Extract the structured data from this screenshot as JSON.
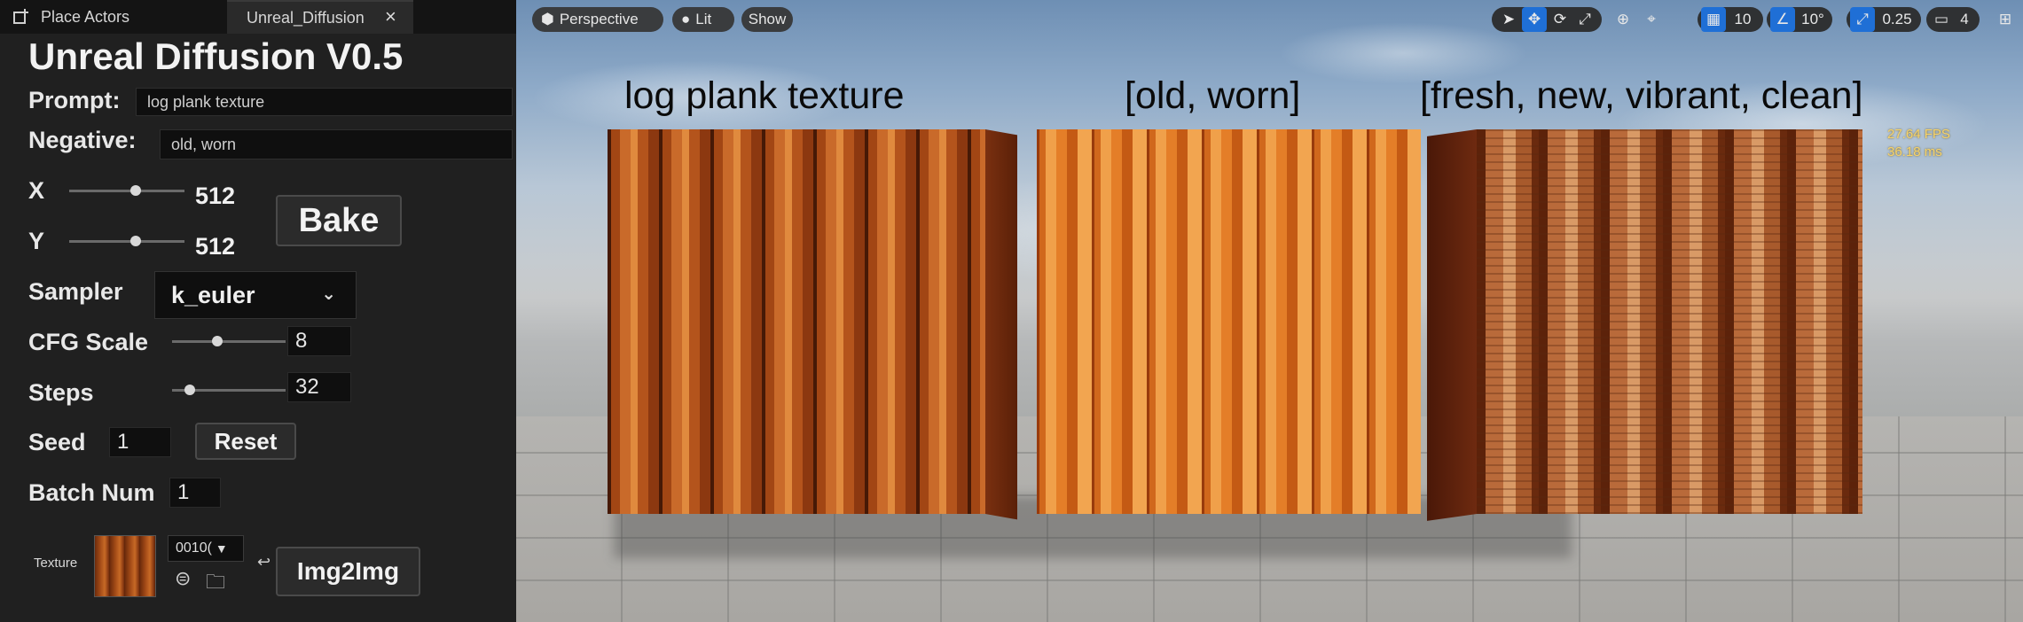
{
  "tabs": {
    "place_actors": "Place Actors",
    "unreal_diffusion": "Unreal_Diffusion"
  },
  "panel": {
    "title": "Unreal Diffusion V0.5",
    "prompt_label": "Prompt:",
    "prompt_value": "log plank texture",
    "negative_label": "Negative:",
    "negative_value": "old, worn",
    "x_label": "X",
    "x_value": "512",
    "x_slider_fraction": 0.58,
    "y_label": "Y",
    "y_value": "512",
    "y_slider_fraction": 0.58,
    "bake_label": "Bake",
    "sampler_label": "Sampler",
    "sampler_value": "k_euler",
    "cfg_label": "CFG Scale",
    "cfg_value": "8",
    "cfg_slider_fraction": 0.4,
    "steps_label": "Steps",
    "steps_value": "32",
    "steps_slider_fraction": 0.16,
    "seed_label": "Seed",
    "seed_value": "1",
    "reset_label": "Reset",
    "batch_label": "Batch Num",
    "batch_value": "1",
    "texture_label": "Texture",
    "texture_asset": "0010(",
    "img2img_label": "Img2Img"
  },
  "viewport": {
    "view_mode": "Perspective",
    "lit_label": "Lit",
    "show_label": "Show",
    "grid_snap": "10",
    "rotation_snap": "10°",
    "scale_snap": "0.25",
    "camera_speed": "4",
    "fps": "27.64 FPS",
    "ms": "36.18 ms",
    "captions": [
      "log plank texture",
      "[old, worn]",
      "[fresh, new, vibrant, clean]"
    ]
  },
  "icons": [
    "place-actors-icon",
    "close-icon",
    "chevron-down-icon",
    "browse-icon",
    "folder-icon",
    "reset-arrow-icon",
    "perspective-cube-icon",
    "lit-sphere-icon",
    "select-icon",
    "translate-icon",
    "rotate-icon",
    "scale-icon",
    "world-icon",
    "surface-snap-icon",
    "grid-icon",
    "angle-icon",
    "scale-snap-icon",
    "camera-icon",
    "layout-icon"
  ],
  "colors": {
    "accent_blue": "#1f6fd6",
    "stats_yellow": "#f7d36a",
    "panel_bg": "#202020"
  }
}
